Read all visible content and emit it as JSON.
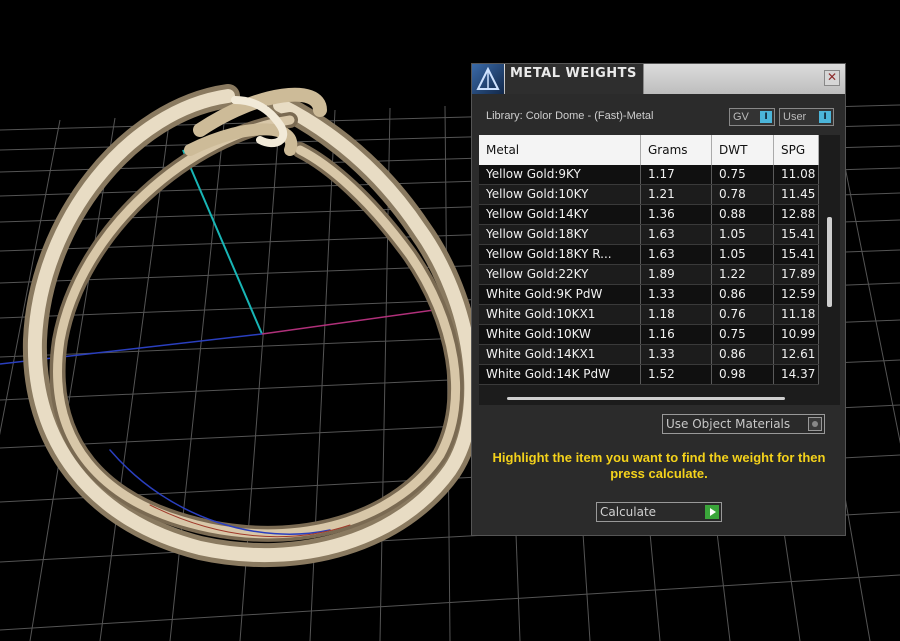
{
  "panel": {
    "title": "METAL WEIGHTS",
    "close_glyph": "✕",
    "library_label": "Library: Color Dome - (Fast)-Metal",
    "toggles": {
      "gv": "GV",
      "user": "User",
      "knob_glyph": "I"
    },
    "table": {
      "columns": [
        "Metal",
        "Grams",
        "DWT",
        "SPG"
      ],
      "rows": [
        [
          "Yellow Gold:9KY",
          "1.17",
          "0.75",
          "11.08"
        ],
        [
          "Yellow Gold:10KY",
          "1.21",
          "0.78",
          "11.45"
        ],
        [
          "Yellow Gold:14KY",
          "1.36",
          "0.88",
          "12.88"
        ],
        [
          "Yellow Gold:18KY",
          "1.63",
          "1.05",
          "15.41"
        ],
        [
          "Yellow Gold:18KY R...",
          "1.63",
          "1.05",
          "15.41"
        ],
        [
          "Yellow Gold:22KY",
          "1.89",
          "1.22",
          "17.89"
        ],
        [
          "White Gold:9K PdW",
          "1.33",
          "0.86",
          "12.59"
        ],
        [
          "White Gold:10KX1",
          "1.18",
          "0.76",
          "11.18"
        ],
        [
          "White Gold:10KW",
          "1.16",
          "0.75",
          "10.99"
        ],
        [
          "White Gold:14KX1",
          "1.33",
          "0.86",
          "12.61"
        ],
        [
          "White Gold:14K PdW",
          "1.52",
          "0.98",
          "14.37"
        ]
      ]
    },
    "use_materials_label": "Use Object Materials",
    "instructions": "Highlight the item you want to find the weight for then press calculate.",
    "calculate_label": "Calculate"
  },
  "colors": {
    "accent_toggle": "#4bb5d9",
    "instructions": "#f4d21b",
    "go_button": "#3aa53a",
    "ring_metal": "#d8c7a8"
  },
  "icons": [
    "app-logo-icon",
    "close-icon",
    "radio-icon",
    "play-icon"
  ]
}
